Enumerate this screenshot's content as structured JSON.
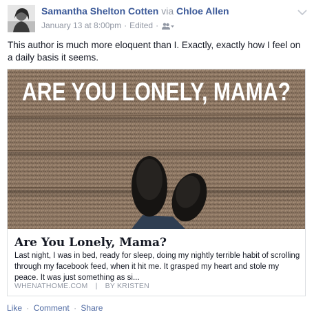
{
  "post": {
    "author": "Samantha Shelton Cotten",
    "via_word": "via",
    "via_name": "Chloe Allen",
    "timestamp": "January 13 at 8:00pm",
    "edited": "Edited",
    "dot": "·",
    "privacy_icon": "friends-icon",
    "message": "This author is much more eloquent than I. Exactly, exactly how I feel on a daily basis it seems."
  },
  "link_card": {
    "image_text": "ARE YOU LONELY, MAMA?",
    "title": "Are You Lonely, Mama?",
    "description": "Last night, I was in bed, ready for sleep, doing my nightly terrible habit of scrolling through my facebook feed, when it hit me. It grasped my heart and stole my peace. It was just something as si...",
    "domain": "WHENATHOME.COM",
    "separator": "|",
    "byline": "BY KRISTEN"
  },
  "actions": {
    "like": "Like",
    "comment": "Comment",
    "share": "Share",
    "dot": "·"
  },
  "colors": {
    "link_blue": "#3b5998",
    "meta_gray": "#9197a3",
    "action_blue": "#4e69a2",
    "card_border": "#dddfe2"
  }
}
